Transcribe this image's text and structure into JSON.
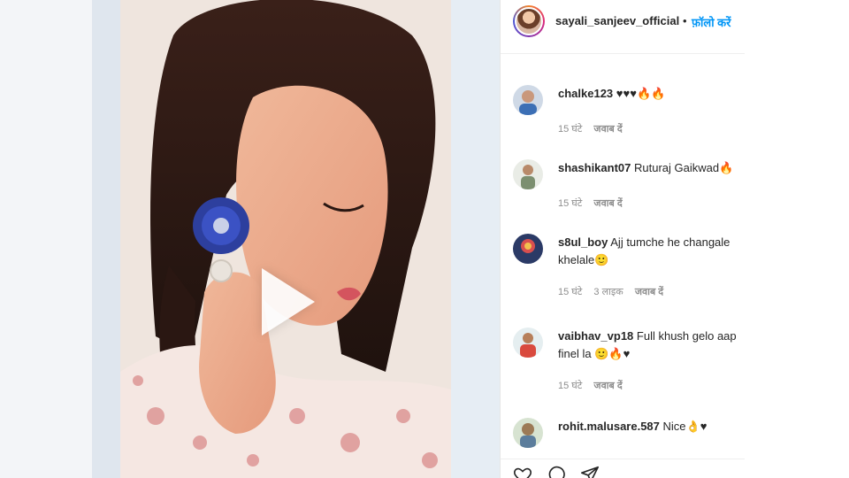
{
  "post": {
    "username": "sayali_sanjeev_official",
    "follow_separator": "•",
    "follow_label": "फ़ॉलो करें"
  },
  "colors": {
    "link": "#0095f6",
    "text": "#262626",
    "muted": "#8e8e8e"
  },
  "comments": [
    {
      "username": "chalke123",
      "text": "♥♥♥🔥🔥",
      "time": "15 घंटे",
      "likes": "",
      "reply": "जवाब दें"
    },
    {
      "username": "shashikant07",
      "text": "Ruturaj Gaikwad🔥",
      "time": "15 घंटे",
      "likes": "",
      "reply": "जवाब दें"
    },
    {
      "username": "s8ul_boy",
      "text": "Ajj tumche he changale khelale🙂",
      "time": "15 घंटे",
      "likes": "3 लाइक",
      "reply": "जवाब दें"
    },
    {
      "username": "vaibhav_vp18",
      "text": "Full khush gelo aap finel la 🙂🔥♥",
      "time": "15 घंटे",
      "likes": "",
      "reply": "जवाब दें"
    },
    {
      "username": "rohit.malusare.587",
      "text": "Nice👌♥",
      "time": "",
      "likes": "",
      "reply": ""
    }
  ],
  "actions": {
    "icons": [
      "heart-icon",
      "comment-icon",
      "share-icon"
    ]
  }
}
